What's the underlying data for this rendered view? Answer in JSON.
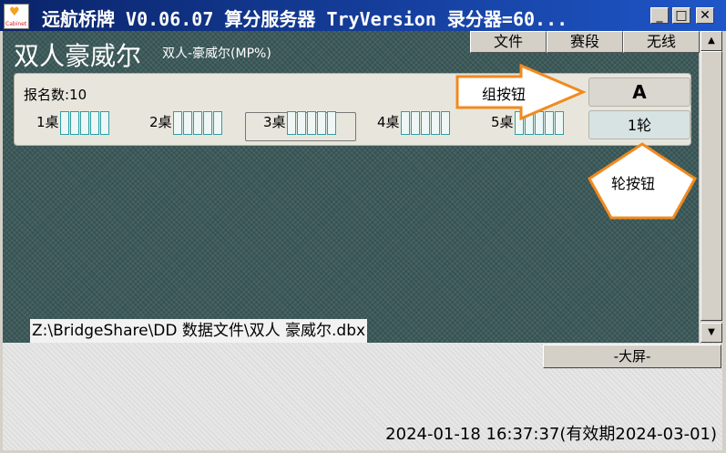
{
  "window": {
    "title": "远航桥牌 V0.06.07 算分服务器 TryVersion 录分器=60...",
    "minimize_glyph": "_",
    "maximize_glyph": "□",
    "close_glyph": "✕"
  },
  "header": {
    "event_title": "双人豪威尔",
    "event_subtitle": "双人-豪威尔(MP%)"
  },
  "menu": {
    "file": "文件",
    "stage": "赛段",
    "wireless": "无线"
  },
  "panel": {
    "registration": "报名数:10",
    "tables": [
      {
        "label": "1桌"
      },
      {
        "label": "2桌"
      },
      {
        "label": "3桌"
      },
      {
        "label": "4桌"
      },
      {
        "label": "5桌"
      }
    ],
    "group_button": "A",
    "round_button": "1轮"
  },
  "annotations": {
    "group_button_label": "组按钮",
    "round_button_label": "轮按钮"
  },
  "file_path": "Z:\\BridgeShare\\DD 数据文件\\双人 豪威尔.dbx",
  "bottom": {
    "big_screen_button": "-大屏-",
    "datetime": "2024-01-18 16:37:37(有效期2024-03-01)"
  },
  "colors": {
    "title_bar": "#0a246a",
    "main_bg": "#3e5b5b",
    "slot_border": "#2f9fa3",
    "callout_fill": "#f28a1e"
  },
  "icons": {
    "app": "bridge-logo-icon",
    "scroll_up": "arrow-up-icon",
    "scroll_down": "arrow-down-icon"
  }
}
